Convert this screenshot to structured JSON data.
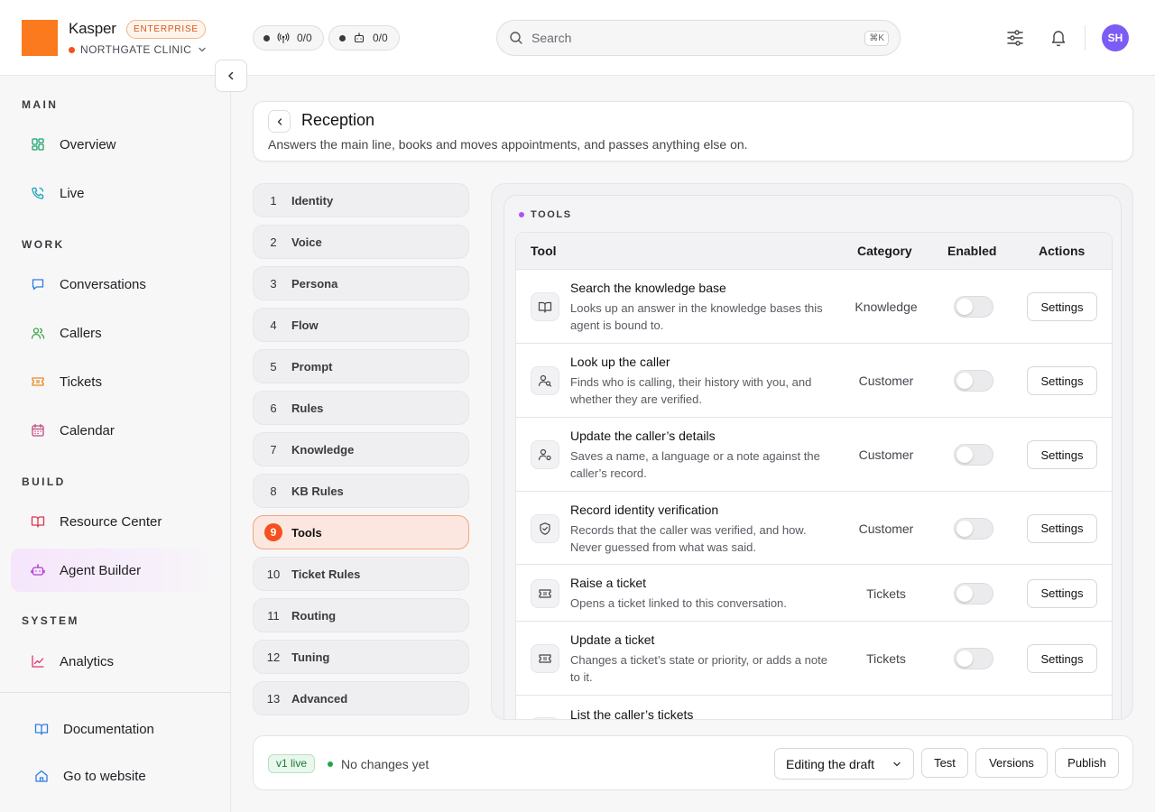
{
  "header": {
    "brand": "Kasper",
    "plan_badge": "ENTERPRISE",
    "org": "NORTHGATE CLINIC",
    "chip_calls": "0/0",
    "chip_agents": "0/0",
    "search_placeholder": "Search",
    "search_shortcut": "⌘K",
    "avatar_initials": "SH",
    "brand_color": "#fb7a1e",
    "avatar_color": "#7c5cf5"
  },
  "sidebar": {
    "sections": {
      "main": "MAIN",
      "work": "WORK",
      "build": "BUILD",
      "system": "SYSTEM"
    },
    "items": {
      "overview": "Overview",
      "live": "Live",
      "conversations": "Conversations",
      "callers": "Callers",
      "tickets": "Tickets",
      "calendar": "Calendar",
      "resource_center": "Resource Center",
      "agent_builder": "Agent Builder",
      "analytics": "Analytics",
      "documentation": "Documentation",
      "go_to_website": "Go to website"
    },
    "active_item": "Agent Builder"
  },
  "agent": {
    "title": "Reception",
    "description": "Answers the main line, books and moves appointments, and passes anything else on."
  },
  "steps": [
    {
      "num": "1",
      "label": "Identity"
    },
    {
      "num": "2",
      "label": "Voice"
    },
    {
      "num": "3",
      "label": "Persona"
    },
    {
      "num": "4",
      "label": "Flow"
    },
    {
      "num": "5",
      "label": "Prompt"
    },
    {
      "num": "6",
      "label": "Rules"
    },
    {
      "num": "7",
      "label": "Knowledge"
    },
    {
      "num": "8",
      "label": "KB Rules"
    },
    {
      "num": "9",
      "label": "Tools"
    },
    {
      "num": "10",
      "label": "Ticket Rules"
    },
    {
      "num": "11",
      "label": "Routing"
    },
    {
      "num": "12",
      "label": "Tuning"
    },
    {
      "num": "13",
      "label": "Advanced"
    }
  ],
  "active_step": "9",
  "tools": {
    "section_label": "TOOLS",
    "columns": {
      "tool": "Tool",
      "category": "Category",
      "enabled": "Enabled",
      "actions": "Actions"
    },
    "rows": [
      {
        "title": "Search the knowledge base",
        "desc": "Looks up an answer in the knowledge bases this agent is bound to.",
        "category": "Knowledge",
        "enabled": false,
        "action": "Settings",
        "icon": "book-icon"
      },
      {
        "title": "Look up the caller",
        "desc": "Finds who is calling, their history with you, and whether they are verified.",
        "category": "Customer",
        "enabled": false,
        "action": "Settings",
        "icon": "user-search-icon"
      },
      {
        "title": "Update the caller’s details",
        "desc": "Saves a name, a language or a note against the caller’s record.",
        "category": "Customer",
        "enabled": false,
        "action": "Settings",
        "icon": "user-cog-icon"
      },
      {
        "title": "Record identity verification",
        "desc": "Records that the caller was verified, and how. Never guessed from what was said.",
        "category": "Customer",
        "enabled": false,
        "action": "Settings",
        "icon": "shield-check-icon"
      },
      {
        "title": "Raise a ticket",
        "desc": "Opens a ticket linked to this conversation.",
        "category": "Tickets",
        "enabled": false,
        "action": "Settings",
        "icon": "ticket-icon"
      },
      {
        "title": "Update a ticket",
        "desc": "Changes a ticket’s state or priority, or adds a note to it.",
        "category": "Tickets",
        "enabled": false,
        "action": "Settings",
        "icon": "ticket-icon"
      },
      {
        "title": "List the caller’s tickets",
        "desc": "",
        "category": "",
        "enabled": false,
        "action": "",
        "icon": ""
      }
    ]
  },
  "footer": {
    "version_badge": "v1 live",
    "status": "No changes yet",
    "mode_select": "Editing the draft",
    "test": "Test",
    "versions": "Versions",
    "publish": "Publish"
  }
}
